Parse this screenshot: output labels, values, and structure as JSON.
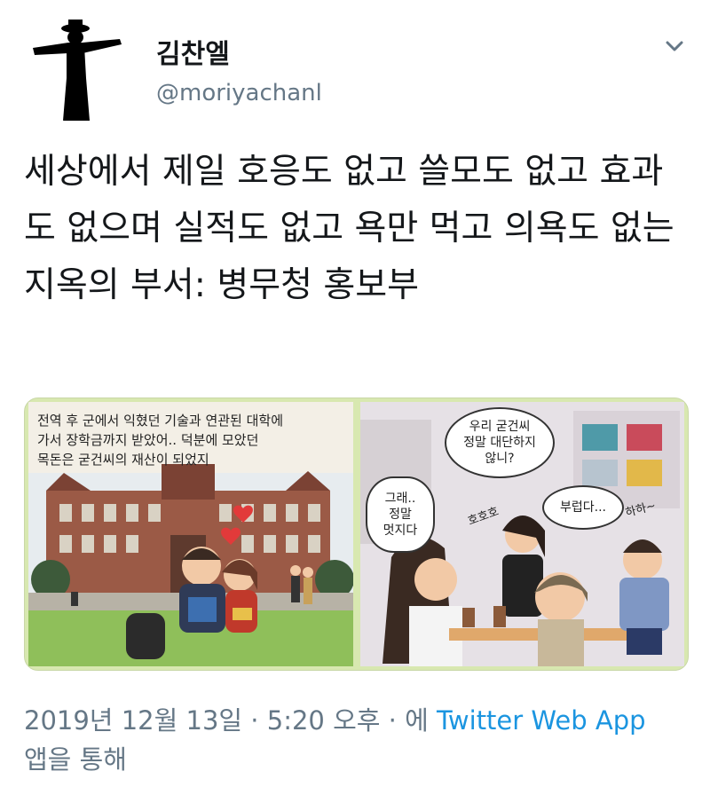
{
  "user": {
    "display_name": "김찬엘",
    "handle": "@moriyachanl"
  },
  "tweet": {
    "text": "세상에서 제일 호응도 없고 쓸모도 없고 효과도 없으며 실적도 없고 욕만 먹고 의욕도 없는 지옥의 부서: 병무청 홍보부"
  },
  "media": {
    "left_panel": {
      "caption_lines": [
        "전역 후 군에서 익혔던 기술과 연관된 대학에",
        "가서 장학금까지 받았어.. 덕분에 모았던",
        "목돈은 굳건씨의 재산이 되었지"
      ]
    },
    "right_panel": {
      "bubble_1": [
        "우리 굳건씨",
        "정말 대단하지",
        "않니?"
      ],
      "bubble_2": [
        "그래..",
        "정말",
        "멋지다"
      ],
      "bubble_3": [
        "부럽다..."
      ],
      "sfx_1": "호호호",
      "sfx_2": "하하~"
    }
  },
  "footer": {
    "date": "2019년 12월 13일 · 5:20 오후 · 에 ",
    "source": "Twitter Web App",
    "suffix": "앱을 통해"
  },
  "icons": {
    "chevron": "chevron-down-icon"
  },
  "colors": {
    "link": "#1b95e0",
    "secondary_text": "#657786"
  }
}
